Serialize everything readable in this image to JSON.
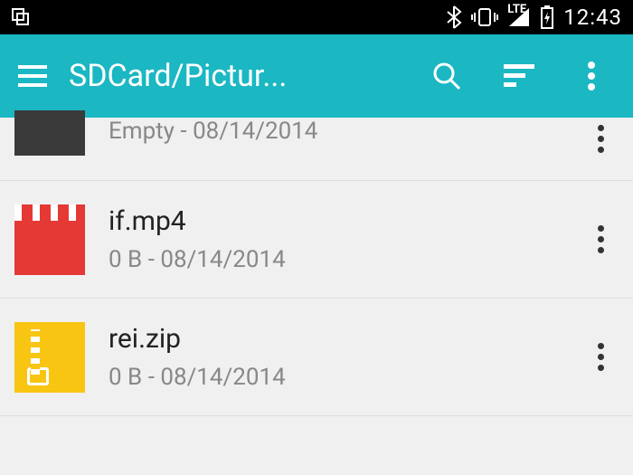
{
  "status_bar": {
    "time": "12:43",
    "network": "LTE"
  },
  "action_bar": {
    "title": "SDCard/Pictur..."
  },
  "files": [
    {
      "name": "",
      "meta": "Empty - 08/14/2014",
      "type": "folder"
    },
    {
      "name": "if.mp4",
      "meta": "0 B - 08/14/2014",
      "type": "video"
    },
    {
      "name": "rei.zip",
      "meta": "0 B - 08/14/2014",
      "type": "archive"
    }
  ]
}
